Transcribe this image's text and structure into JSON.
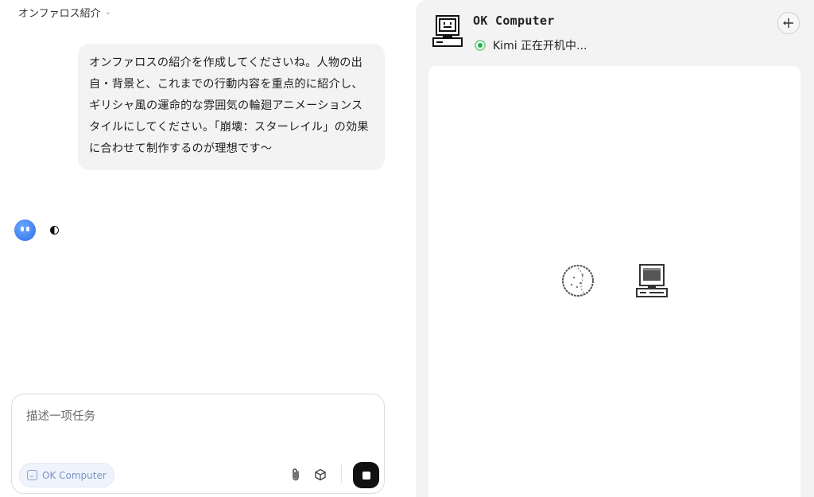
{
  "conversation": {
    "title": "オンファロス紹介"
  },
  "messages": {
    "user_text": "オンファロスの紹介を作成してくださいね。人物の出自・背景と、これまでの行動内容を重点的に紹介し、ギリシャ風の運命的な雰囲気の輪廻アニメーションスタイルにしてください。「崩壊：スターレイル」の効果に合わせて制作するのが理想です～"
  },
  "composer": {
    "placeholder": "描述一项任务",
    "chip_label": "OK Computer"
  },
  "computer": {
    "title": "OK Computer",
    "status": "Kimi 正在开机中..."
  },
  "colors": {
    "status_green": "#22b14c",
    "avatar_blue": "#2f6fe8",
    "chip_bg": "#eef3fc"
  }
}
